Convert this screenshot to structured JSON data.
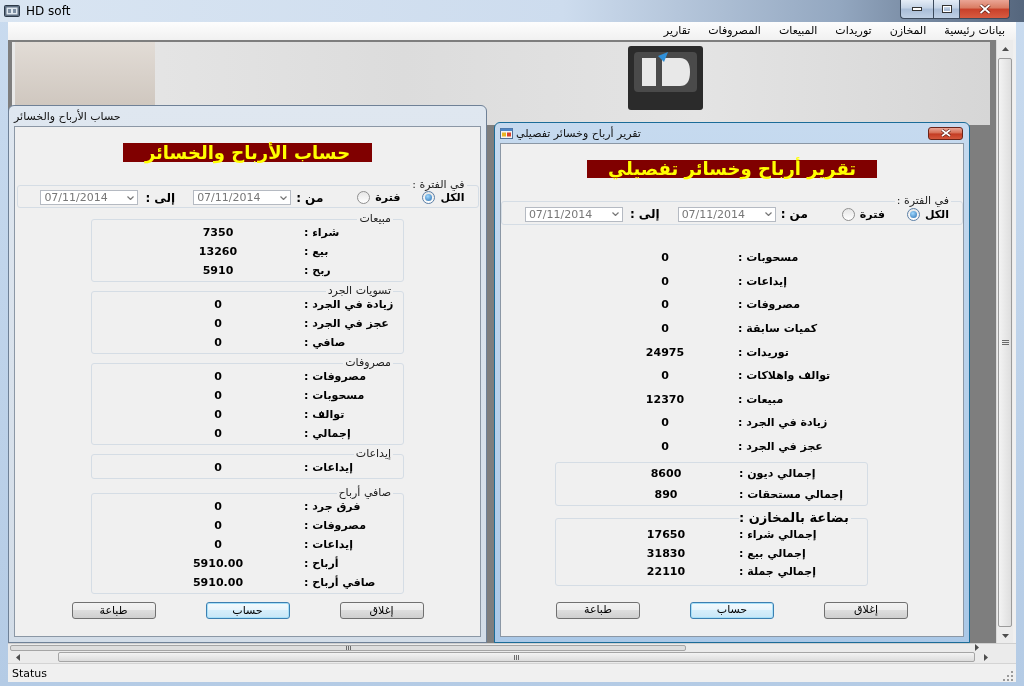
{
  "window": {
    "title": "HD soft"
  },
  "menu": [
    "بيانات رئيسية",
    "المخازن",
    "توريدات",
    "المبيعات",
    "المصروفات",
    "تقارير"
  ],
  "dialogs": [
    {
      "title": "تقرير أرباح وخسائر تفصيلي",
      "active": true,
      "show_icon": true,
      "close_button": true,
      "heading": "تقرير أرباح وخسائر تفصيلي",
      "period": {
        "legend": "في الفترة :",
        "options": [
          {
            "label": "الكل",
            "selected": true
          },
          {
            "label": "فترة",
            "selected": false
          }
        ],
        "from_label": "من :",
        "from_date": {
          "value": "07/11/2014",
          "disabled": true
        },
        "to_label": "إلى :",
        "to_date": {
          "value": "07/11/2014",
          "disabled": true
        }
      },
      "sections": [
        {
          "kind": "plain",
          "rows": [
            {
              "label": "مسحوبات :",
              "value": "0"
            },
            {
              "label": "إيداعات :",
              "value": "0"
            },
            {
              "label": "مصروفات :",
              "value": "0"
            },
            {
              "label": "كميات سابقة :",
              "value": "0"
            },
            {
              "label": "توريدات :",
              "value": "24975"
            },
            {
              "label": "توالف واهلاكات :",
              "value": "0"
            },
            {
              "label": "مبيعات :",
              "value": "12370"
            },
            {
              "label": "زيادة في الجرد :",
              "value": "0"
            },
            {
              "label": "عجز في الجرد :",
              "value": "0"
            }
          ]
        },
        {
          "kind": "group",
          "rows": [
            {
              "label": "إجمالي ديون :",
              "value": "8600"
            },
            {
              "label": "إجمالي مستحقات :",
              "value": "890"
            }
          ]
        },
        {
          "kind": "bold-group",
          "title": "بضاعة بالمخازن :",
          "rows": [
            {
              "label": "إجمالي شراء :",
              "value": "17650"
            },
            {
              "label": "إجمالي بيع :",
              "value": "31830"
            },
            {
              "label": "إجمالي جملة :",
              "value": "22110"
            }
          ]
        }
      ],
      "buttons": [
        {
          "label": "إغلاق",
          "focused": false
        },
        {
          "label": "حساب",
          "focused": true
        },
        {
          "label": "طباعة",
          "focused": false
        }
      ]
    },
    {
      "title": "حساب الأرباح والخسائر",
      "active": false,
      "show_icon": false,
      "close_button": false,
      "heading": "حساب الأرباح والخسائر",
      "period": {
        "legend": "في الفترة :",
        "options": [
          {
            "label": "الكل",
            "selected": true
          },
          {
            "label": "فترة",
            "selected": false
          }
        ],
        "from_label": "من :",
        "from_date": {
          "value": "07/11/2014",
          "disabled": true
        },
        "to_label": "إلى :",
        "to_date": {
          "value": "07/11/2014",
          "disabled": true
        }
      },
      "sections": [
        {
          "kind": "group",
          "title": "مبيعات",
          "rows": [
            {
              "label": "شراء :",
              "value": "7350"
            },
            {
              "label": "بيع :",
              "value": "13260"
            },
            {
              "label": "ربح :",
              "value": "5910"
            }
          ]
        },
        {
          "kind": "group",
          "title": "تسويات الجرد",
          "rows": [
            {
              "label": "زيادة في الجرد :",
              "value": "0"
            },
            {
              "label": "عجز في الجرد :",
              "value": "0"
            },
            {
              "label": "صافي :",
              "value": "0"
            }
          ]
        },
        {
          "kind": "group",
          "title": "مصروفات",
          "rows": [
            {
              "label": "مصروفات :",
              "value": "0"
            },
            {
              "label": "مسحوبات :",
              "value": "0"
            },
            {
              "label": "توالف :",
              "value": "0"
            },
            {
              "label": "إجمالي :",
              "value": "0"
            }
          ]
        },
        {
          "kind": "group",
          "title": "إيداعات",
          "rows": [
            {
              "label": "إيداعات :",
              "value": "0"
            }
          ]
        },
        {
          "kind": "group",
          "title": "صافي أرباح",
          "rows": [
            {
              "label": "فرق جرد :",
              "value": "0"
            },
            {
              "label": "مصروفات :",
              "value": "0"
            },
            {
              "label": "إيداعات :",
              "value": "0"
            },
            {
              "label": "أرباح :",
              "value": "5910.00"
            },
            {
              "label": "صافي أرباح :",
              "value": "5910.00"
            }
          ]
        }
      ],
      "buttons": [
        {
          "label": "إغلاق",
          "focused": false
        },
        {
          "label": "حساب",
          "focused": true
        },
        {
          "label": "طباعة",
          "focused": false
        }
      ]
    }
  ],
  "status_bar": {
    "text": "Status"
  }
}
